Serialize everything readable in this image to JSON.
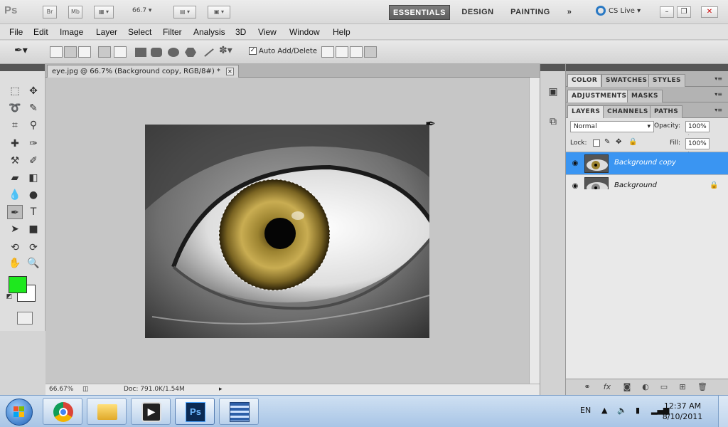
{
  "app": {
    "logo": "Ps",
    "zoom_level": "66.7",
    "workspaces": [
      "ESSENTIALS",
      "DESIGN",
      "PAINTING"
    ],
    "more": "»",
    "cs_live": "CS Live"
  },
  "menu": [
    "File",
    "Edit",
    "Image",
    "Layer",
    "Select",
    "Filter",
    "Analysis",
    "3D",
    "View",
    "Window",
    "Help"
  ],
  "options": {
    "auto_add_delete_label": "Auto Add/Delete",
    "auto_add_delete_checked": true
  },
  "document": {
    "tab_title": "eye.jpg @ 66.7% (Background copy, RGB/8#) *",
    "status_zoom": "66.67%",
    "status_doc": "Doc: 791.0K/1.54M"
  },
  "panels": {
    "group1_tabs": [
      "COLOR",
      "SWATCHES",
      "STYLES"
    ],
    "group2_tabs": [
      "ADJUSTMENTS",
      "MASKS"
    ],
    "group3_tabs": [
      "LAYERS",
      "CHANNELS",
      "PATHS"
    ],
    "blend_mode": "Normal",
    "opacity_label": "Opacity:",
    "opacity_value": "100%",
    "lock_label": "Lock:",
    "fill_label": "Fill:",
    "fill_value": "100%",
    "layers": [
      {
        "name": "Background copy",
        "selected": true
      },
      {
        "name": "Background",
        "locked": true
      }
    ]
  },
  "taskbar": {
    "apps": [
      "chrome",
      "explorer",
      "media-center",
      "photoshop",
      "movie-maker"
    ],
    "language": "EN",
    "time": "12:37 AM",
    "date": "8/10/2011"
  },
  "colors": {
    "foreground": "#1ee81e",
    "background": "#ffffff",
    "layer_selected": "#3a95f2"
  }
}
